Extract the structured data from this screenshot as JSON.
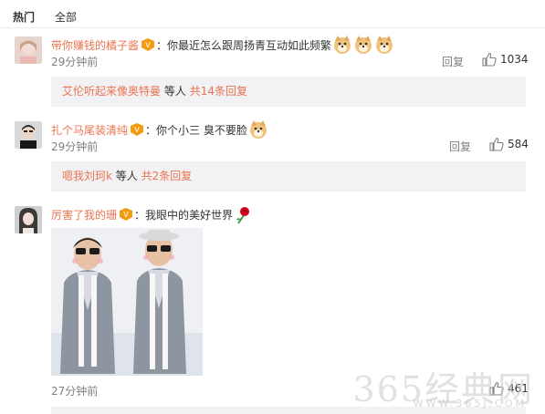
{
  "tabs": [
    {
      "label": "热门",
      "active": true
    },
    {
      "label": "全部",
      "active": false
    }
  ],
  "comments": [
    {
      "username": "带你赚钱的橘子酱",
      "text": "：你最近怎么跟周扬青互动如此频繁",
      "emoji_icons": [
        "doge-icon",
        "doge-icon",
        "doge-icon"
      ],
      "time": "29分钟前",
      "reply_label": "回复",
      "likes": "1034",
      "sub_names": "艾伦听起来像奥特曼",
      "sub_mid": "等人",
      "sub_more": "共14条回复"
    },
    {
      "username": "扎个马尾装清纯",
      "text": "：你个小三  臭不要脸",
      "emoji_icons": [
        "doge-icon"
      ],
      "time": "29分钟前",
      "reply_label": "回复",
      "likes": "584",
      "sub_names": "嗯我刘珂k",
      "sub_mid": "等人",
      "sub_more": "共2条回复"
    },
    {
      "username": "厉害了我的珊",
      "text": "：我眼中的美好世界",
      "emoji_icons": [
        "rose-icon"
      ],
      "time": "27分钟前",
      "likes": "461"
    }
  ],
  "watermark": {
    "text": "365经典网",
    "url": "WWW.365J.COM"
  },
  "colors": {
    "accent": "#eb7350",
    "muted": "#808080",
    "subbg": "#f2f2f5"
  }
}
